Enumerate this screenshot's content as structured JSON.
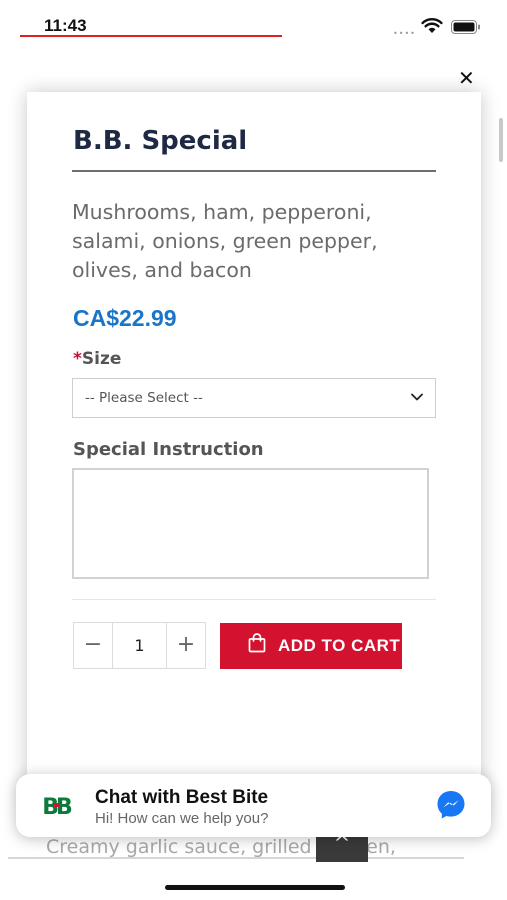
{
  "status_bar": {
    "time": "11:43",
    "dots": "••••"
  },
  "background": {
    "close_symbol": "✕",
    "teaser_text": "Creamy garlic sauce, grilled chicken,",
    "scroll_top_symbol": "^"
  },
  "modal": {
    "title": "B.B. Special",
    "description": "Mushrooms, ham, pepperoni, salami, onions, green pepper, olives, and bacon",
    "price": "CA$22.99",
    "size": {
      "required_mark": "*",
      "label": "Size",
      "selected": "-- Please Select --"
    },
    "special_instruction": {
      "label": "Special Instruction",
      "value": ""
    },
    "quantity": {
      "minus": "−",
      "value": "1",
      "plus": "+"
    },
    "add_to_cart": "ADD TO CART"
  },
  "chat": {
    "title": "Chat with Best Bite",
    "subtitle": "Hi! How can we help you?",
    "logo_text": "BB"
  },
  "colors": {
    "accent_red": "#d2122e",
    "price_blue": "#1a75c9",
    "title_navy": "#1e2a44",
    "logo_green": "#0b7a3a",
    "messenger_blue": "#1877f2"
  },
  "icons": {
    "wifi": "wifi-icon",
    "battery": "battery-icon",
    "close": "close-icon",
    "chevron": "chevron-down-icon",
    "bag": "shopping-bag-icon",
    "messenger": "messenger-icon"
  }
}
